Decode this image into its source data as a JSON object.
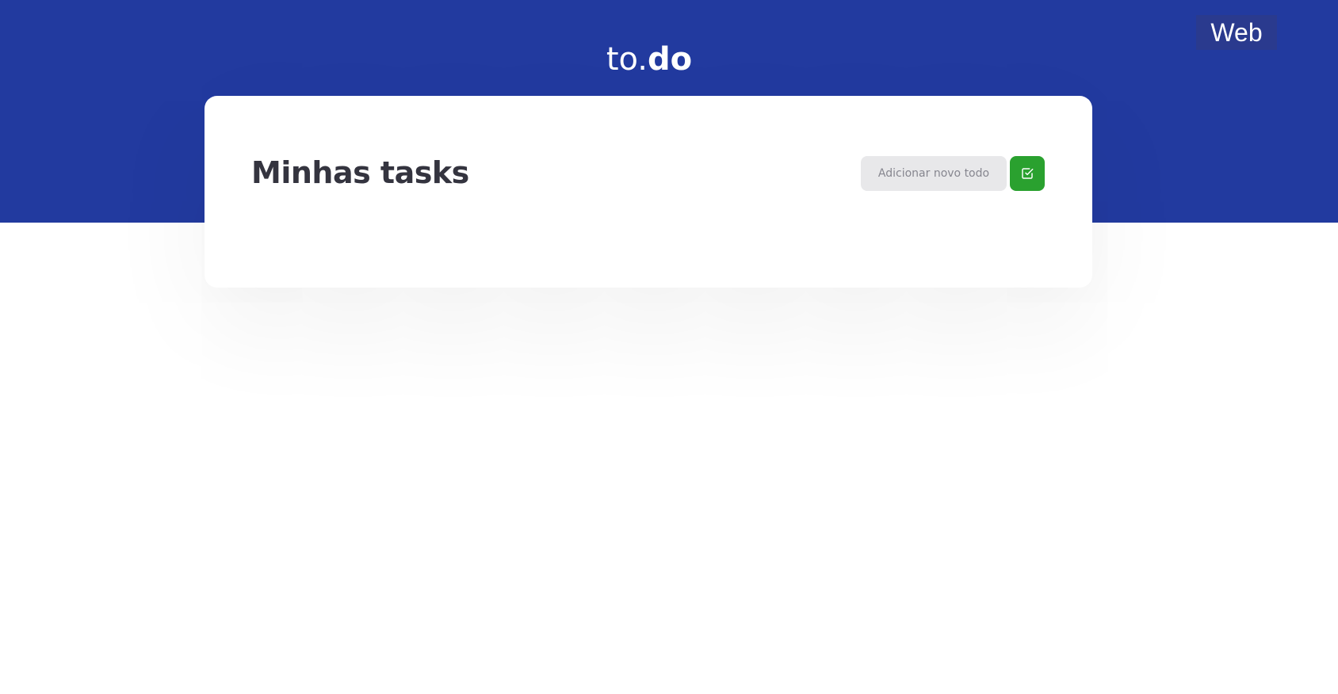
{
  "header": {
    "logo": {
      "light_part": "to.",
      "bold_part": "do"
    },
    "platform_badge": "Web",
    "background_color": "#223a9f"
  },
  "card": {
    "title": "Minhas tasks",
    "new_todo_input": {
      "value": "",
      "placeholder": "Adicionar novo todo"
    },
    "add_button": {
      "icon": "check-square-icon",
      "color": "#2aa12f"
    }
  },
  "colors": {
    "accent": "#223a9f",
    "success": "#2aa12f",
    "title_text": "#34343f",
    "input_background": "#e8e8ea"
  }
}
